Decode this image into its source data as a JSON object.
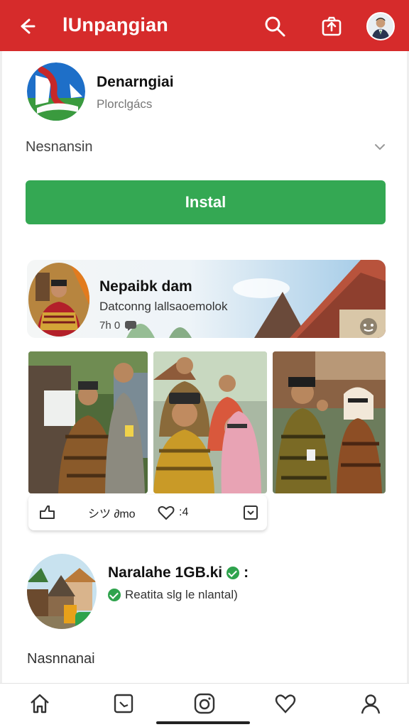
{
  "header": {
    "title": "lUnpaŋgian",
    "icons": [
      "back-arrow-icon",
      "search-icon",
      "share-icon",
      "profile-avatar"
    ]
  },
  "app": {
    "name": "Denarngiai",
    "subtitle": "Plorclgács",
    "description_label": "Nesnansin",
    "install_label": "Instal"
  },
  "featured": {
    "title": "Nepaibk dam",
    "subtitle": "Datconng lallsaoemolok",
    "meta": "7h 0"
  },
  "post_actions": {
    "share_label": "シツ ∂mo",
    "like_label": "♡ :4"
  },
  "second_post": {
    "title": "Naralahe 1GB.ki",
    "more": ":",
    "subtitle": "Reatita slg le nlantal)"
  },
  "section_label": "Nasnnanai",
  "colors": {
    "header_red": "#d62b2b",
    "install_green": "#34a853",
    "verified_green": "#2fa34d"
  },
  "bottom_nav": [
    "home-icon",
    "media-icon",
    "camera-icon",
    "heart-icon",
    "profile-icon"
  ]
}
